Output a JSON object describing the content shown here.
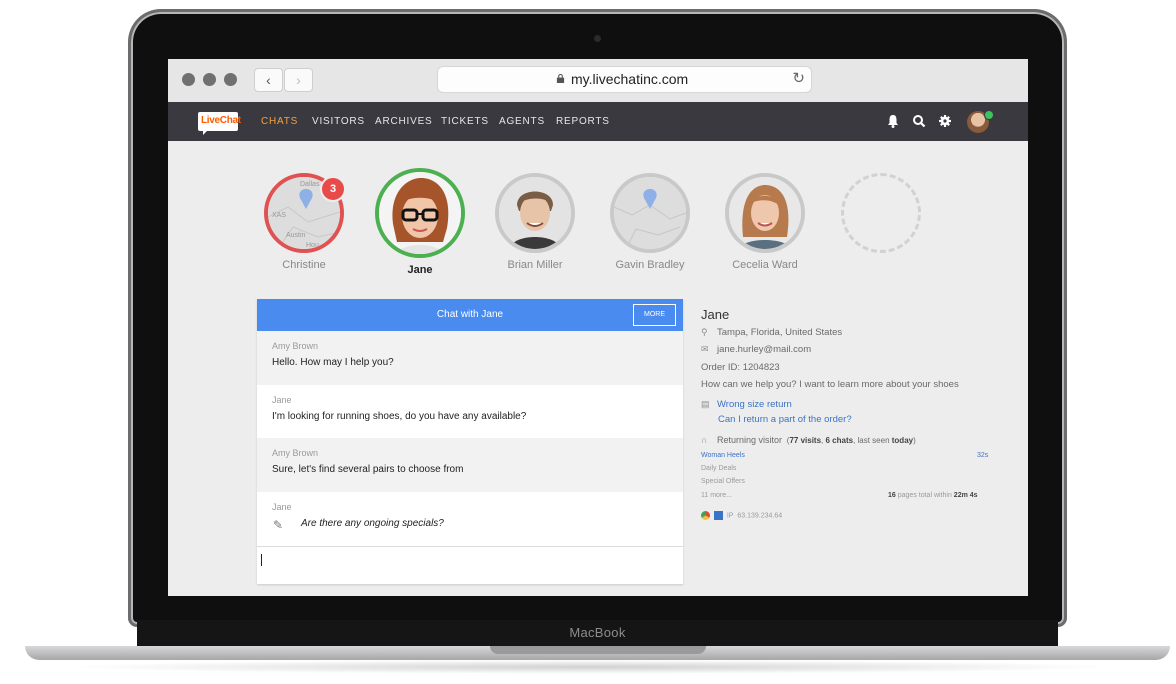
{
  "browser": {
    "url": "my.livechatinc.com"
  },
  "device": {
    "label": "MacBook"
  },
  "app": {
    "logo_text": "LiveChat",
    "nav": [
      {
        "label": "CHATS",
        "active": true
      },
      {
        "label": "VISITORS"
      },
      {
        "label": "ARCHIVES"
      },
      {
        "label": "TICKETS"
      },
      {
        "label": "AGENTS"
      },
      {
        "label": "REPORTS"
      }
    ],
    "icons": [
      "bell-icon",
      "search-icon",
      "gear-icon",
      "user-avatar"
    ]
  },
  "chats_row": [
    {
      "name": "Christine",
      "badge": "3",
      "ring": "#e05252",
      "type": "map",
      "map_labels": [
        "Dallas",
        "XAS",
        "Austin",
        "Hou"
      ]
    },
    {
      "name": "Jane",
      "ring": "#4caf50",
      "active": true,
      "type": "photo"
    },
    {
      "name": "Brian Miller",
      "ring": "#c9c9c9",
      "type": "photo"
    },
    {
      "name": "Gavin Bradley",
      "ring": "#c9c9c9",
      "type": "map"
    },
    {
      "name": "Cecelia Ward",
      "ring": "#c9c9c9",
      "type": "photo"
    }
  ],
  "chat": {
    "title": "Chat with Jane",
    "more_label": "MORE",
    "messages": [
      {
        "author": "Amy Brown",
        "text": "Hello. How may I help you?"
      },
      {
        "author": "Jane",
        "text": "I'm looking for running shoes, do you have any available?"
      },
      {
        "author": "Amy Brown",
        "text": "Sure, let's find several pairs to choose from"
      },
      {
        "author": "Jane",
        "text": "Are there any ongoing specials?"
      }
    ]
  },
  "visitor": {
    "name": "Jane",
    "location": "Tampa, Florida, United States",
    "email": "jane.hurley@mail.com",
    "order": "Order ID: 1204823",
    "question": "How can we help you? I want to learn more about your shoes",
    "links": [
      "Wrong size return",
      "Can I return a part of the order?"
    ],
    "returning": {
      "label": "Returning visitor",
      "visits": "77 visits",
      "chats": "6 chats",
      "last_seen": "today",
      "stats_prefix": "(",
      "stats_sep1": ", ",
      "stats_sep2": ", last seen ",
      "stats_suffix": ")"
    },
    "pages": {
      "first_page": "Woman Heels",
      "first_time": "32s",
      "others": [
        "Daily Deals",
        "Special Offers"
      ],
      "more": "11 more...",
      "total_count": "16",
      "total_text": "pages total within",
      "total_time": "22m 4s"
    },
    "ip_label": "IP",
    "ip": "63.139.234.64"
  },
  "colors": {
    "accent": "#4a8bf0",
    "nav_bg": "#3b3940",
    "active_nav": "#f2a13c",
    "online": "#3ac45c",
    "badge": "#e84a4a"
  }
}
